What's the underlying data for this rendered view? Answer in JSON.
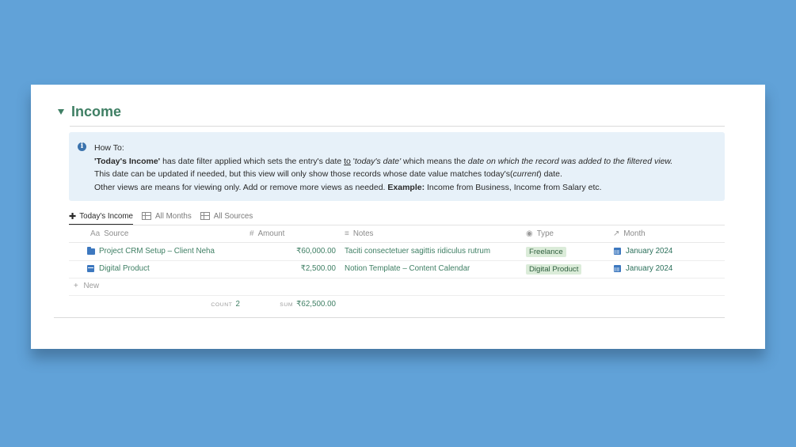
{
  "section": {
    "title": "Income"
  },
  "callout": {
    "heading": "How To:",
    "line1_bold": "'Today's Income'",
    "line1_a": " has date filter applied which sets the entry's date ",
    "line1_to": "to",
    "line1_b": " '",
    "line1_it1": "today's date'",
    "line1_c": " which means the ",
    "line1_it2": "date on which the record was added to the filtered view.",
    "line2_a": "This date can be updated if needed, but this view will only show those records whose date value matches today's(",
    "line2_it": "current",
    "line2_b": ") date.",
    "line3_a": "Other views are means for viewing only. Add or remove more views as needed. ",
    "line3_bold": "Example:",
    "line3_b": " Income from Business, Income from Salary etc."
  },
  "views": [
    {
      "label": "Today's Income",
      "icon": "plus-icon",
      "active": true
    },
    {
      "label": "All Months",
      "icon": "table-icon",
      "active": false
    },
    {
      "label": "All Sources",
      "icon": "table-icon",
      "active": false
    }
  ],
  "columns": {
    "source": {
      "glyph": "Aa",
      "label": "Source"
    },
    "amount": {
      "glyph": "#",
      "label": "Amount"
    },
    "notes": {
      "glyph": "≡",
      "label": "Notes"
    },
    "type": {
      "glyph": "◉",
      "label": "Type"
    },
    "month": {
      "glyph": "↗",
      "label": "Month"
    }
  },
  "rows": [
    {
      "source": "Project CRM Setup – Client Neha",
      "source_icon": "folder-icon",
      "amount": "₹60,000.00",
      "notes": "Taciti consectetuer sagittis ridiculus rutrum",
      "type": "Freelance",
      "month": "January 2024"
    },
    {
      "source": "Digital Product",
      "source_icon": "box-icon",
      "amount": "₹2,500.00",
      "notes": "Notion Template – Content Calendar",
      "type": "Digital Product",
      "month": "January 2024"
    }
  ],
  "new_row": {
    "label": "New"
  },
  "summary": {
    "count_label": "COUNT",
    "count_value": "2",
    "sum_label": "SUM",
    "sum_value": "₹62,500.00"
  },
  "colors": {
    "accent": "#3f7f64",
    "callout_bg": "#e7f1f9",
    "background": "#61a2d8",
    "tag_bg": "#dbecd9",
    "icon_blue": "#3d78bf"
  }
}
